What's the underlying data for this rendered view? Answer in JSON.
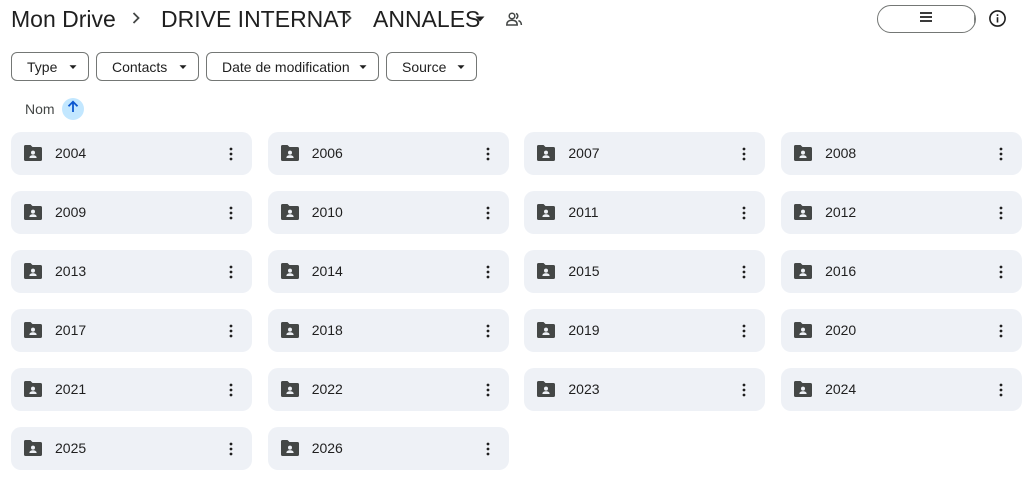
{
  "breadcrumb": {
    "items": [
      {
        "label": "Mon Drive"
      },
      {
        "label": "DRIVE INTERNAT"
      },
      {
        "label": "ANNALES"
      }
    ]
  },
  "icons": {
    "share": "shared-people-icon",
    "list_view": "list-view-icon",
    "grid_view": "grid-view-icon",
    "info": "info-icon",
    "folder": "shared-folder-icon",
    "more": "more-vert-icon",
    "sort": "arrow-up-icon"
  },
  "colors": {
    "accent": "#c2e7ff",
    "tile_bg": "#eef1f6",
    "text": "#1f1f1f",
    "border": "#747775"
  },
  "filters": [
    {
      "label": "Type"
    },
    {
      "label": "Contacts"
    },
    {
      "label": "Date de modification"
    },
    {
      "label": "Source"
    }
  ],
  "sort": {
    "label": "Nom",
    "direction": "ascending"
  },
  "folders": [
    {
      "name": "2004"
    },
    {
      "name": "2006"
    },
    {
      "name": "2007"
    },
    {
      "name": "2008"
    },
    {
      "name": "2009"
    },
    {
      "name": "2010"
    },
    {
      "name": "2011"
    },
    {
      "name": "2012"
    },
    {
      "name": "2013"
    },
    {
      "name": "2014"
    },
    {
      "name": "2015"
    },
    {
      "name": "2016"
    },
    {
      "name": "2017"
    },
    {
      "name": "2018"
    },
    {
      "name": "2019"
    },
    {
      "name": "2020"
    },
    {
      "name": "2021"
    },
    {
      "name": "2022"
    },
    {
      "name": "2023"
    },
    {
      "name": "2024"
    },
    {
      "name": "2025"
    },
    {
      "name": "2026"
    }
  ]
}
